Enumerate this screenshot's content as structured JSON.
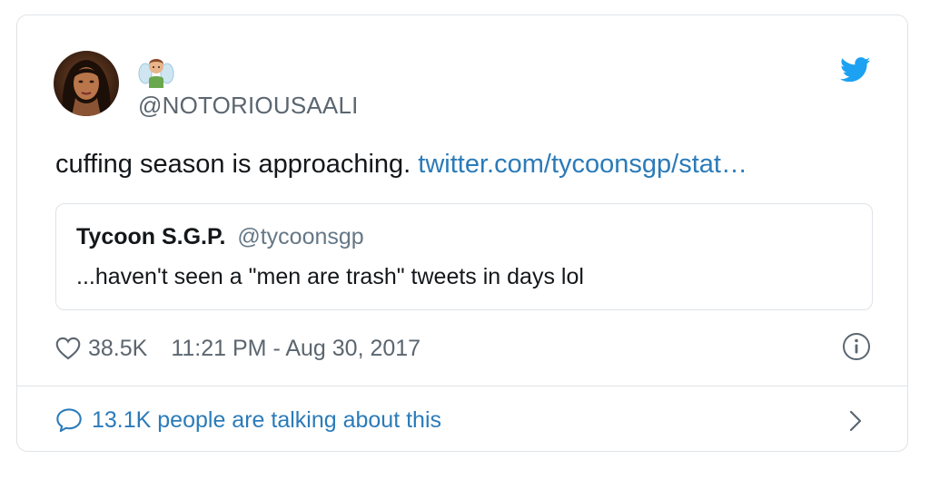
{
  "author": {
    "handle": "@NOTORIOUSAALI",
    "emoji": "man-fairy-emoji"
  },
  "tweet": {
    "text": "cuffing season is approaching. ",
    "link": "twitter.com/tycoonsgp/stat…"
  },
  "quote": {
    "name": "Tycoon S.G.P.",
    "handle": "@tycoonsgp",
    "text": "...haven't seen a \"men are trash\" tweets in days lol"
  },
  "meta": {
    "likes": "38.5K",
    "timestamp": "11:21 PM - Aug 30, 2017"
  },
  "footer": {
    "talking": "13.1K people are talking about this"
  },
  "icons": {
    "brand": "twitter-bird-icon",
    "like": "heart-icon",
    "info": "info-icon",
    "reply": "speech-bubble-icon",
    "more": "chevron-right-icon"
  },
  "colors": {
    "link": "#2b7bb9",
    "brand": "#1da1f2",
    "muted": "#5b6670",
    "text": "#14171a",
    "border": "#dfe3e7"
  }
}
